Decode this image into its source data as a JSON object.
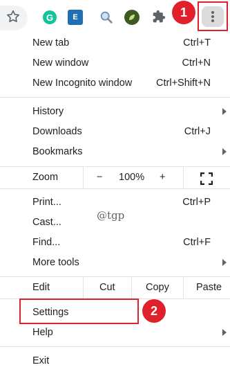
{
  "toolbar": {
    "icons": [
      "star-icon",
      "grammarly-icon",
      "dictionary-icon",
      "search-icon",
      "leaf-icon",
      "extensions-icon",
      "kebab-menu-icon"
    ],
    "grammarly_letter": "G",
    "book_glyph": "E"
  },
  "annotations": {
    "badge1": "1",
    "badge2": "2",
    "accent": "#e0202b"
  },
  "menu": {
    "new_tab": {
      "label": "New tab",
      "shortcut": "Ctrl+T"
    },
    "new_window": {
      "label": "New window",
      "shortcut": "Ctrl+N"
    },
    "new_incognito": {
      "label": "New Incognito window",
      "shortcut": "Ctrl+Shift+N"
    },
    "history": {
      "label": "History"
    },
    "downloads": {
      "label": "Downloads",
      "shortcut": "Ctrl+J"
    },
    "bookmarks": {
      "label": "Bookmarks"
    },
    "zoom": {
      "label": "Zoom",
      "minus": "−",
      "level": "100%",
      "plus": "+"
    },
    "print": {
      "label": "Print...",
      "shortcut": "Ctrl+P"
    },
    "cast": {
      "label": "Cast..."
    },
    "find": {
      "label": "Find...",
      "shortcut": "Ctrl+F"
    },
    "more_tools": {
      "label": "More tools"
    },
    "edit": {
      "label": "Edit",
      "cut": "Cut",
      "copy": "Copy",
      "paste": "Paste"
    },
    "settings": {
      "label": "Settings"
    },
    "help": {
      "label": "Help"
    },
    "exit": {
      "label": "Exit"
    }
  },
  "watermark": "@tgp"
}
